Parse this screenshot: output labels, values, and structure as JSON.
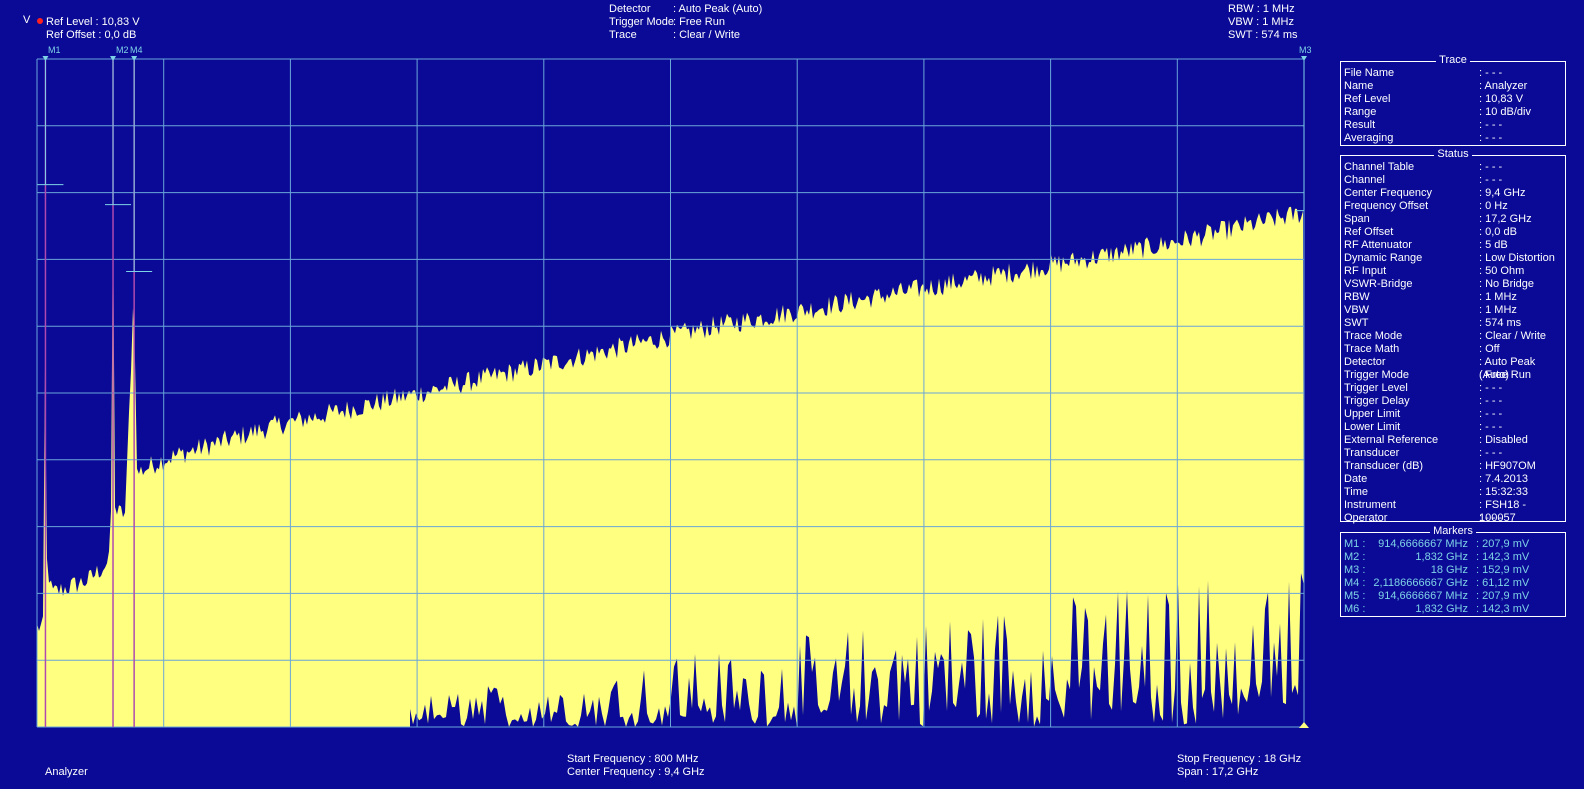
{
  "header": {
    "unit": "V",
    "ref_level_label": "Ref Level : 10,83 V",
    "ref_offset_label": "Ref Offset :  0,0   dB",
    "detector_key": "Detector",
    "detector_val": ": Auto Peak (Auto)",
    "trigger_key": "Trigger Mode",
    "trigger_val": ": Free Run",
    "trace_key": "Trace",
    "trace_val": ": Clear / Write",
    "rbw": "RBW :     1 MHz",
    "vbw": "VBW :     1 MHz",
    "swt": "SWT : 574 ms"
  },
  "markers_top": {
    "m1": "M1",
    "m2": "M2",
    "m4": "M4",
    "m3": "M3"
  },
  "trace_box": {
    "title": "Trace",
    "rows": [
      {
        "k": "File Name",
        "v": ": - - -"
      },
      {
        "k": "Name",
        "v": ": Analyzer"
      },
      {
        "k": "Ref Level",
        "v": ":  10,83 V"
      },
      {
        "k": "Range",
        "v": ": 10 dB/div"
      },
      {
        "k": "Result",
        "v": ": - - -"
      },
      {
        "k": "Averaging",
        "v": ": - - -"
      }
    ]
  },
  "status_box": {
    "title": "Status",
    "rows": [
      {
        "k": "Channel Table",
        "v": ": - - -"
      },
      {
        "k": "Channel",
        "v": ": - - -"
      },
      {
        "k": "Center Frequency",
        "v": ":     9,4   GHz"
      },
      {
        "k": "Frequency Offset",
        "v": ":       0    Hz"
      },
      {
        "k": "Span",
        "v": ":   17,2   GHz"
      },
      {
        "k": "Ref Offset",
        "v": ":     0,0   dB"
      },
      {
        "k": "RF Attenuator",
        "v": ":       5    dB"
      },
      {
        "k": "Dynamic Range",
        "v": ": Low Distortion"
      },
      {
        "k": "RF Input",
        "v": ":    50    Ohm"
      },
      {
        "k": "VSWR-Bridge",
        "v": ": No Bridge"
      },
      {
        "k": "RBW",
        "v": ":       1    MHz"
      },
      {
        "k": "VBW",
        "v": ":       1    MHz"
      },
      {
        "k": "SWT",
        "v": ":   574    ms"
      },
      {
        "k": "Trace Mode",
        "v": ": Clear / Write"
      },
      {
        "k": "Trace Math",
        "v": ": Off"
      },
      {
        "k": "Detector",
        "v": ": Auto Peak (Auto)"
      },
      {
        "k": "Trigger Mode",
        "v": ": Free Run"
      },
      {
        "k": "Trigger Level",
        "v": ": - - -"
      },
      {
        "k": "Trigger Delay",
        "v": ": - - -"
      },
      {
        "k": "Upper Limit",
        "v": ": - - -"
      },
      {
        "k": "Lower Limit",
        "v": ": - - -"
      },
      {
        "k": "External Reference",
        "v": ": Disabled"
      },
      {
        "k": "Transducer",
        "v": ": - - -"
      },
      {
        "k": "Transducer (dB)",
        "v": ": HF907OM"
      },
      {
        "k": "Date",
        "v": ": 7.4.2013"
      },
      {
        "k": "Time",
        "v": ": 15:32:33"
      },
      {
        "k": "Instrument",
        "v": ": FSH18 - 100057"
      },
      {
        "k": "Operator",
        "v": ": - - -"
      }
    ]
  },
  "markers_box": {
    "title": "Markers",
    "rows": [
      {
        "m": "M1 :",
        "f": "914,6666667 MHz",
        "v": ":  207,9 mV"
      },
      {
        "m": "M2 :",
        "f": "1,832 GHz",
        "v": ":  142,3 mV"
      },
      {
        "m": "M3 :",
        "f": "18 GHz",
        "v": ":  152,9 mV"
      },
      {
        "m": "M4 :",
        "f": "2,1186666667 GHz",
        "v": ":  61,12 mV"
      },
      {
        "m": "M5 :",
        "f": "914,6666667 MHz",
        "v": ":  207,9 mV"
      },
      {
        "m": "M6 :",
        "f": "1,832 GHz",
        "v": ":  142,3 mV"
      }
    ]
  },
  "footer": {
    "mode": "Analyzer",
    "start_label": "Start Frequency  :  800    MHz",
    "center_label": "Center Frequency :      9,4 GHz",
    "stop_label": "Stop Frequency : 18    GHz",
    "span_label": "Span              : 17,2 GHz"
  },
  "colors": {
    "background": "#0a0a96",
    "trace_fill": "#ffff80",
    "grid": "#6aa6d8",
    "marker": "#7fd3e6",
    "marker_line": "#b04ab0",
    "rec_dot": "#ff2020"
  },
  "chart_data": {
    "type": "area",
    "title": "",
    "xlabel": "",
    "ylabel": "",
    "x_range_ghz": [
      0.8,
      18
    ],
    "ref_level_v": 10.83,
    "range_db_per_div": 10,
    "trace_max_envelope": {
      "x_ghz": [
        0.8,
        0.9,
        0.9147,
        0.93,
        1.0,
        1.5,
        1.8,
        1.832,
        1.86,
        2.0,
        2.1187,
        2.15,
        2.5,
        4,
        6,
        8,
        10,
        12,
        14,
        16,
        18
      ],
      "level_db_rel_ref": [
        -85,
        -85,
        -20,
        -75,
        -80,
        -78,
        -75,
        -23,
        -68,
        -68,
        -33,
        -62,
        -60,
        -55,
        -50,
        -45,
        -40,
        -36,
        -32,
        -28,
        -23
      ]
    },
    "markers": [
      {
        "name": "M1",
        "x": "914,6666667 MHz",
        "value": "207,9 mV"
      },
      {
        "name": "M2",
        "x": "1,832 GHz",
        "value": "142,3 mV"
      },
      {
        "name": "M3",
        "x": "18 GHz",
        "value": "152,9 mV"
      },
      {
        "name": "M4",
        "x": "2,1186666667 GHz",
        "value": "61,12 mV"
      }
    ]
  }
}
